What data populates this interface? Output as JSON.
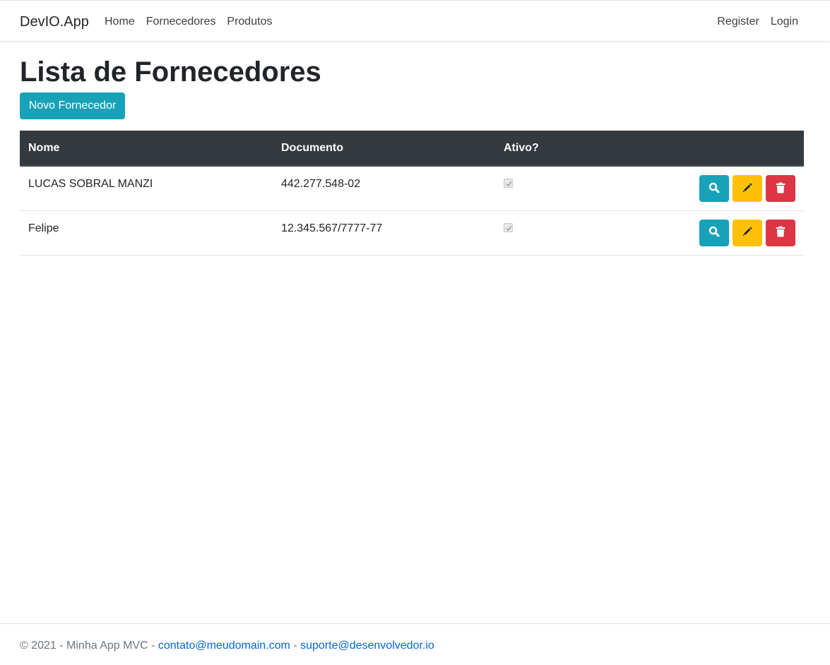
{
  "navbar": {
    "brand": "DevIO.App",
    "left_links": [
      "Home",
      "Fornecedores",
      "Produtos"
    ],
    "right_links": [
      "Register",
      "Login"
    ]
  },
  "page": {
    "title": "Lista de Fornecedores",
    "new_button": "Novo Fornecedor"
  },
  "table": {
    "headers": [
      "Nome",
      "Documento",
      "Ativo?"
    ],
    "rows": [
      {
        "nome": "LUCAS SOBRAL MANZI",
        "documento": "442.277.548-02",
        "ativo": true
      },
      {
        "nome": "Felipe",
        "documento": "12.345.567/7777-77",
        "ativo": true
      }
    ],
    "action_icons": [
      "search-icon",
      "pencil-icon",
      "trash-icon"
    ]
  },
  "colors": {
    "info": "#17a2b8",
    "warning": "#ffc107",
    "danger": "#dc3545",
    "table_header": "#343a40"
  },
  "footer": {
    "prefix": "© 2021 - Minha App MVC - ",
    "email1": "contato@meudomain.com",
    "separator": " - ",
    "email2": "suporte@desenvolvedor.io"
  }
}
